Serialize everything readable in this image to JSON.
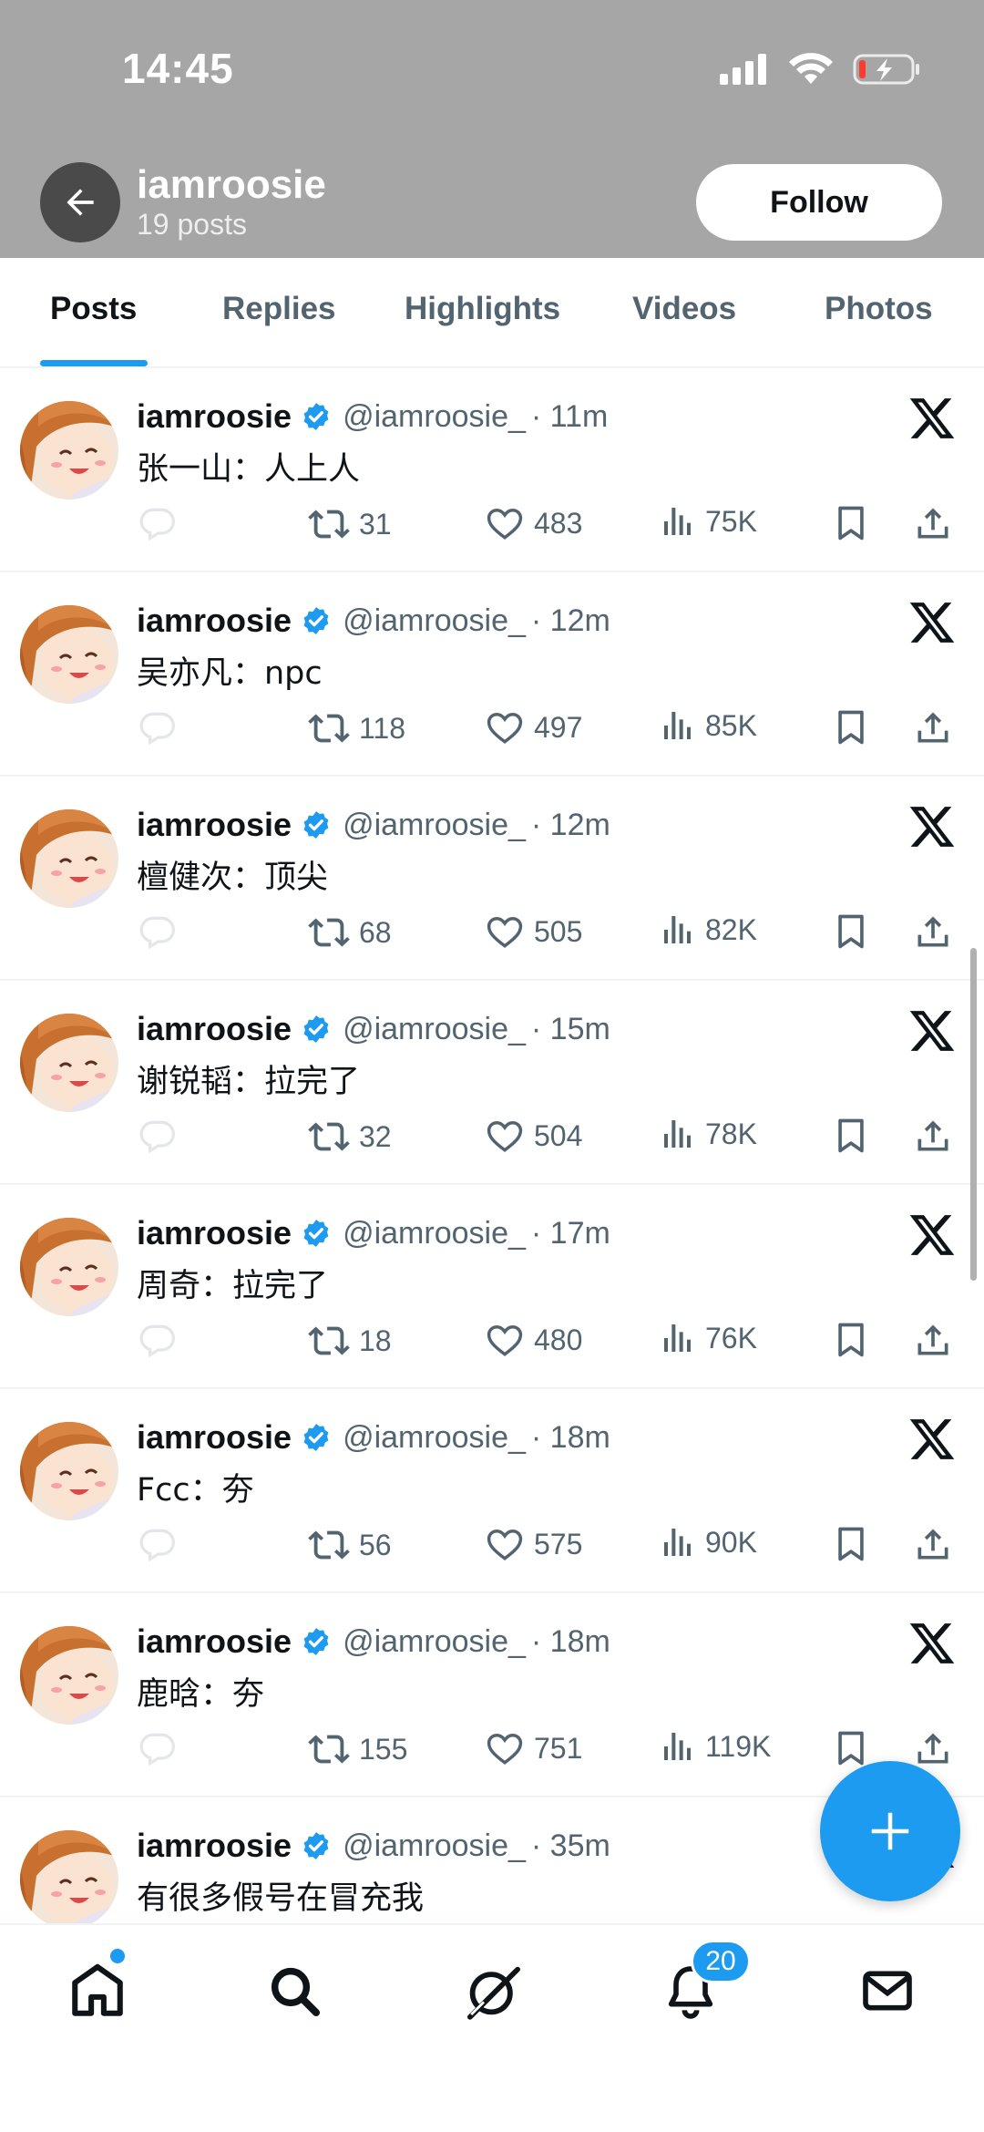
{
  "status_bar": {
    "time": "14:45"
  },
  "header": {
    "name": "iamroosie",
    "post_count": "19 posts",
    "follow_label": "Follow"
  },
  "tabs": [
    {
      "label": "Posts",
      "active": true
    },
    {
      "label": "Replies",
      "active": false
    },
    {
      "label": "Highlights",
      "active": false
    },
    {
      "label": "Videos",
      "active": false
    },
    {
      "label": "Photos",
      "active": false
    }
  ],
  "posts": [
    {
      "name": "iamroosie",
      "handle": "@iamroosie_",
      "time": "· 11m",
      "text": "张一山：人上人",
      "retweets": "31",
      "likes": "483",
      "views": "75K"
    },
    {
      "name": "iamroosie",
      "handle": "@iamroosie_",
      "time": "· 12m",
      "text": "吴亦凡：npc",
      "retweets": "118",
      "likes": "497",
      "views": "85K"
    },
    {
      "name": "iamroosie",
      "handle": "@iamroosie_",
      "time": "· 12m",
      "text": "檀健次：顶尖",
      "retweets": "68",
      "likes": "505",
      "views": "82K"
    },
    {
      "name": "iamroosie",
      "handle": "@iamroosie_",
      "time": "· 15m",
      "text": "谢锐韬：拉完了",
      "retweets": "32",
      "likes": "504",
      "views": "78K"
    },
    {
      "name": "iamroosie",
      "handle": "@iamroosie_",
      "time": "· 17m",
      "text": "周奇：拉完了",
      "retweets": "18",
      "likes": "480",
      "views": "76K"
    },
    {
      "name": "iamroosie",
      "handle": "@iamroosie_",
      "time": "· 18m",
      "text": "Fcc：夯",
      "retweets": "56",
      "likes": "575",
      "views": "90K"
    },
    {
      "name": "iamroosie",
      "handle": "@iamroosie_",
      "time": "· 18m",
      "text": "鹿晗：夯",
      "retweets": "155",
      "likes": "751",
      "views": "119K"
    },
    {
      "name": "iamroosie",
      "handle": "@iamroosie_",
      "time": "· 35m",
      "text": "有很多假号在冒充我",
      "retweets": "",
      "likes": "",
      "views": ""
    }
  ],
  "bottom_nav": {
    "notifications_badge": "20"
  },
  "icons": {
    "back": "arrow-left-icon",
    "verified": "verified-badge-icon",
    "x_logo": "x-logo-icon",
    "reply": "reply-icon",
    "retweet": "retweet-icon",
    "like": "heart-icon",
    "views": "views-icon",
    "bookmark": "bookmark-icon",
    "share": "share-icon",
    "compose": "plus-icon",
    "home": "home-icon",
    "search": "search-icon",
    "grok": "grok-icon",
    "notifications": "bell-icon",
    "messages": "mail-icon"
  },
  "colors": {
    "accent": "#1d9bf0",
    "header_bg": "#a6a6a6",
    "muted_text": "#536471"
  }
}
